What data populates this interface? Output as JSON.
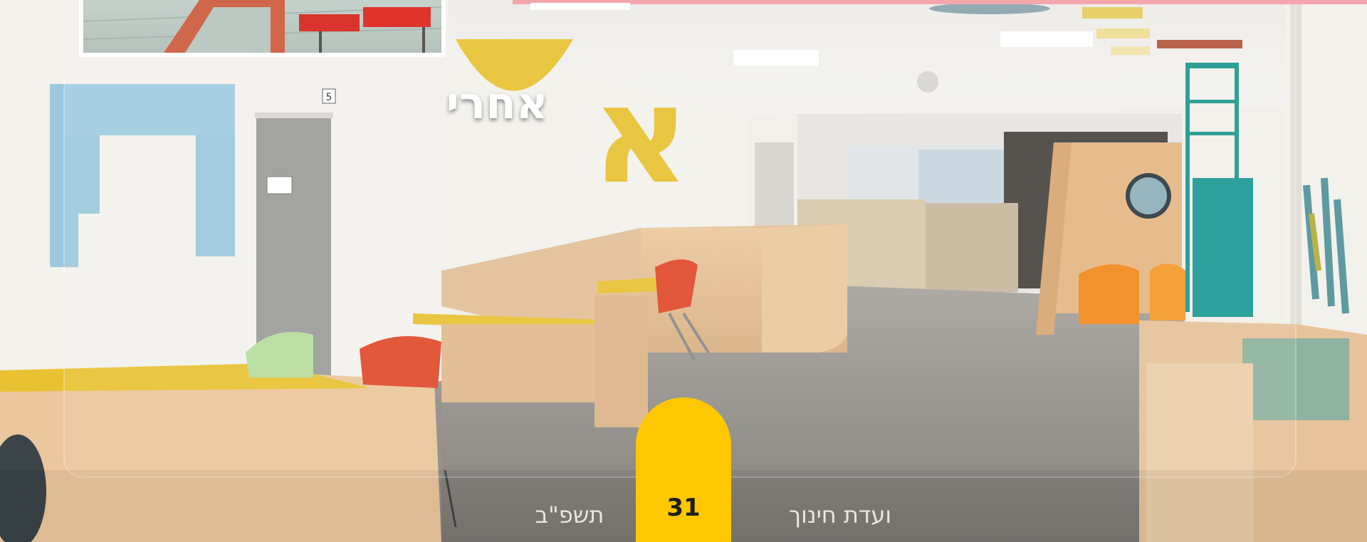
{
  "photo": {
    "after_label": "אחרי",
    "alphabet_letter": "א",
    "wall_letter_left": "ח",
    "door_number": "5"
  },
  "footer": {
    "page_number": "31",
    "year": "תשפ\"ב",
    "committee": "ועדת חינוך"
  },
  "colors": {
    "page_tab": "#ffc700",
    "top_accent_bar": "#f4a6ad",
    "letter_yellow": "#e8c233",
    "wall_blue": "#9cc9dd"
  }
}
